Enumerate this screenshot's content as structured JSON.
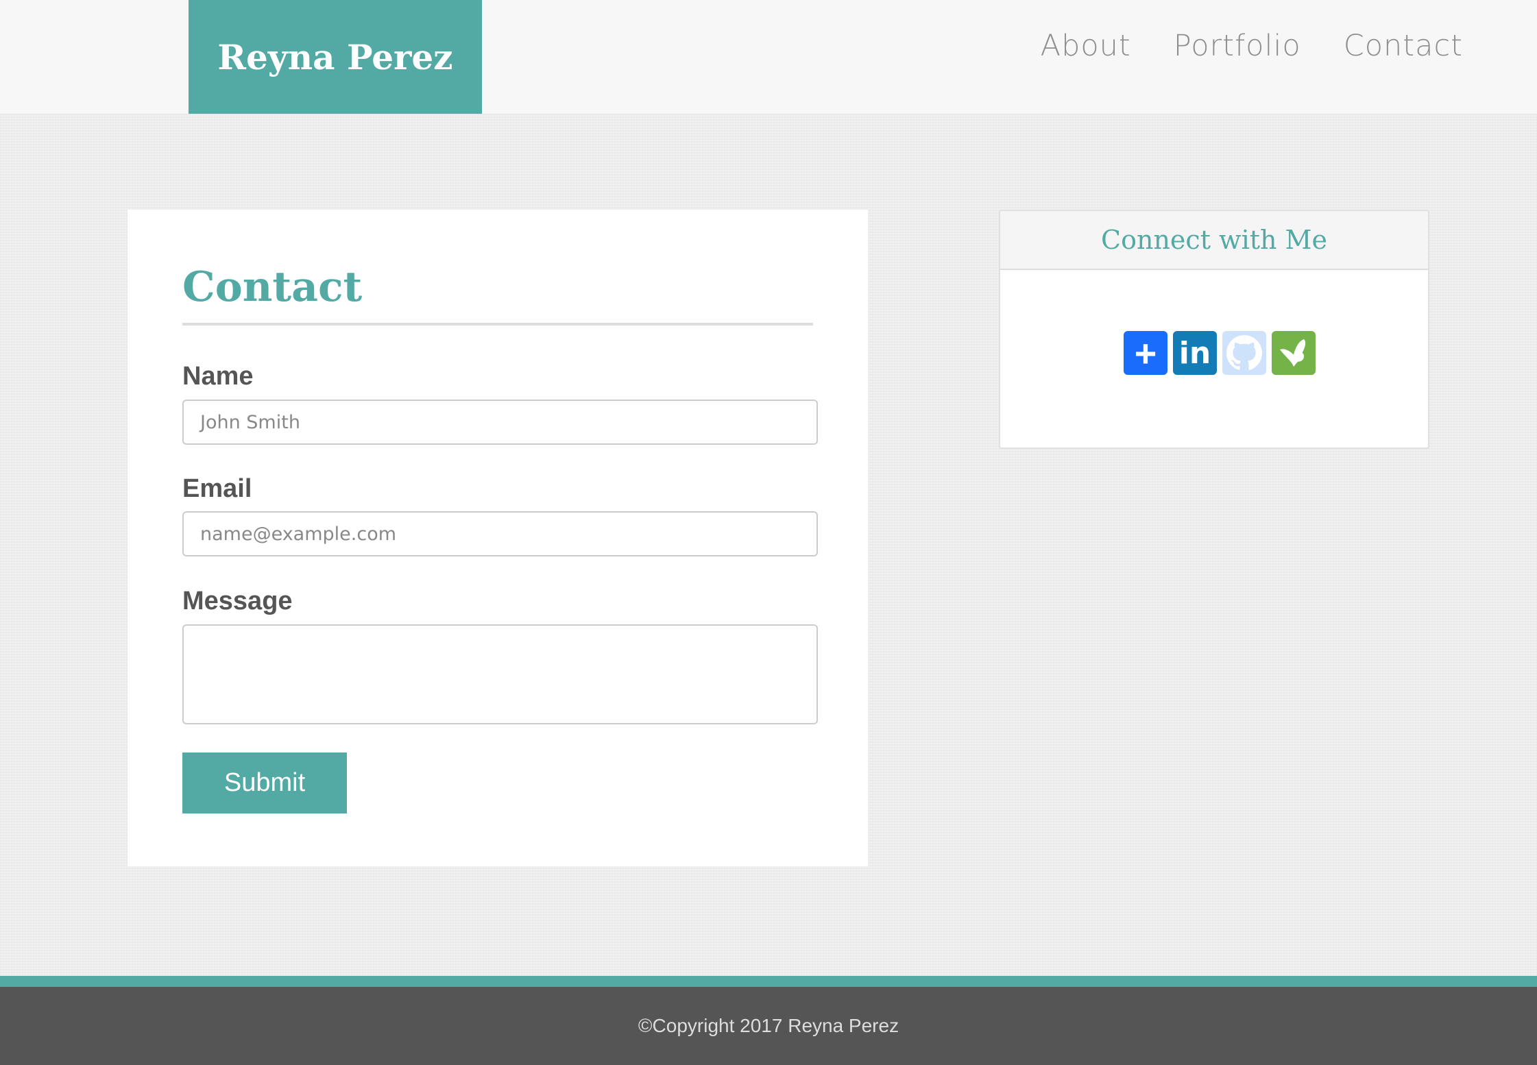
{
  "header": {
    "logo": "Reyna Perez",
    "nav": [
      "About",
      "Portfolio",
      "Contact"
    ]
  },
  "form": {
    "title": "Contact",
    "name_label": "Name",
    "name_placeholder": "John Smith",
    "email_label": "Email",
    "email_placeholder": "name@example.com",
    "message_label": "Message",
    "submit": "Submit"
  },
  "sidebar": {
    "title": "Connect with Me",
    "icons": [
      "add-share-icon",
      "linkedin-icon",
      "github-icon",
      "butterfly-icon"
    ]
  },
  "footer": {
    "copyright": "©Copyright 2017 Reyna Perez"
  }
}
